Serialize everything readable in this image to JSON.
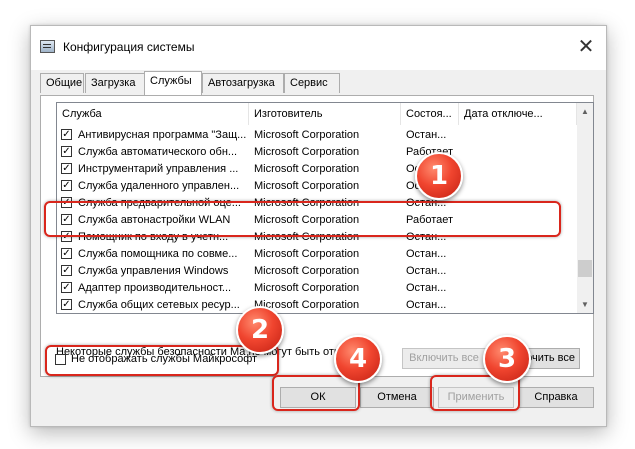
{
  "window": {
    "title": "Конфигурация системы"
  },
  "tabs": [
    {
      "label": "Общие"
    },
    {
      "label": "Загрузка"
    },
    {
      "label": "Службы"
    },
    {
      "label": "Автозагрузка"
    },
    {
      "label": "Сервис"
    }
  ],
  "active_tab": "Службы",
  "columns": [
    "Служба",
    "Изготовитель",
    "Состоя...",
    "Дата отключе..."
  ],
  "rows": [
    {
      "checked": true,
      "name": "Антивирусная программа \"Защ...",
      "maker": "Microsoft Corporation",
      "status": "Остан..."
    },
    {
      "checked": true,
      "name": "Служба автоматического обн...",
      "maker": "Microsoft Corporation",
      "status": "Работает"
    },
    {
      "checked": true,
      "name": "Инструментарий управления ...",
      "maker": "Microsoft Corporation",
      "status": "Остан..."
    },
    {
      "checked": true,
      "name": "Служба удаленного управлен...",
      "maker": "Microsoft Corporation",
      "status": "Остан..."
    },
    {
      "checked": true,
      "name": "Служба предварительной оце...",
      "maker": "Microsoft Corporation",
      "status": "Остан..."
    },
    {
      "checked": true,
      "name": "Служба автонастройки WLAN",
      "maker": "Microsoft Corporation",
      "status": "Работает"
    },
    {
      "checked": true,
      "name": "Помощник по входу в учетн...",
      "maker": "Microsoft Corporation",
      "status": "Остан..."
    },
    {
      "checked": true,
      "name": "Служба помощника по совме...",
      "maker": "Microsoft Corporation",
      "status": "Остан..."
    },
    {
      "checked": true,
      "name": "Служба управления Windows",
      "maker": "Microsoft Corporation",
      "status": "Остан..."
    },
    {
      "checked": true,
      "name": "Адаптер производительност...",
      "maker": "Microsoft Corporation",
      "status": "Остан..."
    },
    {
      "checked": true,
      "name": "Служба общих сетевых ресур...",
      "maker": "Microsoft Corporation",
      "status": "Остан..."
    }
  ],
  "note": "Некоторые службы безопасности Ма    не могут быть отключены.",
  "buttons": {
    "enable_all": "Включить все",
    "disable_all": "Отключить все",
    "ok": "ОК",
    "cancel": "Отмена",
    "apply": "Применить",
    "help": "Справка"
  },
  "hide_ms": {
    "label": "Не отображать службы Майкрософт",
    "checked": false
  },
  "callouts": [
    "1",
    "2",
    "3",
    "4"
  ],
  "colors": {
    "highlight": "#d9261c",
    "callout": "#f0452f"
  }
}
